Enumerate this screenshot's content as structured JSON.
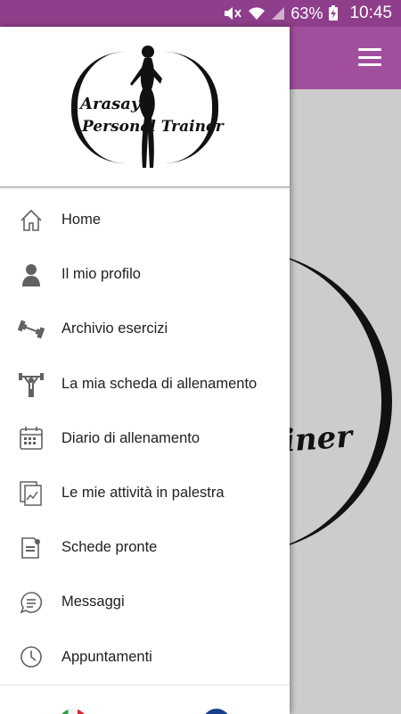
{
  "status_bar": {
    "battery": "63%",
    "time": "10:45"
  },
  "background": {
    "logo_fragment": "iner"
  },
  "drawer": {
    "logo": {
      "line1": "Arasay",
      "line2": "Personal Trainer"
    },
    "items": [
      {
        "label": "Home",
        "icon": "home-icon"
      },
      {
        "label": "Il mio profilo",
        "icon": "profile-icon"
      },
      {
        "label": "Archivio esercizi",
        "icon": "dumbbell-icon"
      },
      {
        "label": "La mia scheda di allenamento",
        "icon": "weightlifter-icon"
      },
      {
        "label": "Diario di allenamento",
        "icon": "calendar-icon"
      },
      {
        "label": "Le mie attività in palestra",
        "icon": "activity-report-icon"
      },
      {
        "label": "Schede pronte",
        "icon": "ready-sheet-icon"
      },
      {
        "label": "Messaggi",
        "icon": "chat-bubble-icon"
      },
      {
        "label": "Appuntamenti",
        "icon": "clock-icon"
      }
    ],
    "footer": {
      "languages": [
        {
          "code": "it",
          "icon": "italy-flag-icon"
        },
        {
          "code": "en",
          "icon": "uk-flag-icon"
        }
      ]
    }
  },
  "colors": {
    "app_bar": "#a14f9d",
    "status_bar": "#8e3e8a"
  }
}
